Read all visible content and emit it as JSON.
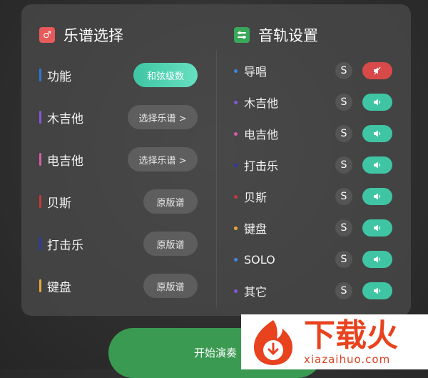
{
  "left": {
    "title": "乐谱选择",
    "icon": "music-note-icon",
    "rows": [
      {
        "label": "功能",
        "button": "和弦级数",
        "bar_color": "#2a78d8"
      },
      {
        "label": "木吉他",
        "button": "选择乐谱 >",
        "bar_color": "#8a55d8"
      },
      {
        "label": "电吉他",
        "button": "选择乐谱 >",
        "bar_color": "#d85aa8"
      },
      {
        "label": "贝斯",
        "button": "原版谱",
        "bar_color": "#c83838"
      },
      {
        "label": "打击乐",
        "button": "原版谱",
        "bar_color": "#2a3aa8"
      },
      {
        "label": "键盘",
        "button": "原版谱",
        "bar_color": "#e8a838"
      }
    ]
  },
  "right": {
    "title": "音轨设置",
    "icon": "track-settings-icon",
    "solo_label": "S",
    "tracks": [
      {
        "label": "导唱",
        "dot_color": "#3a8ae8",
        "enabled": false
      },
      {
        "label": "木吉他",
        "dot_color": "#8a55d8",
        "enabled": true
      },
      {
        "label": "电吉他",
        "dot_color": "#d85aa8",
        "enabled": true
      },
      {
        "label": "打击乐",
        "dot_color": "#2a3aa8",
        "enabled": true
      },
      {
        "label": "贝斯",
        "dot_color": "#c83838",
        "enabled": true
      },
      {
        "label": "键盘",
        "dot_color": "#e8a838",
        "enabled": true
      },
      {
        "label": "SOLO",
        "dot_color": "#3a8ae8",
        "enabled": true
      },
      {
        "label": "其它",
        "dot_color": "#8a55d8",
        "enabled": true
      }
    ]
  },
  "start_button": "开始演奏",
  "watermark": {
    "brand": "下载火",
    "url": "xiazaihuo.com"
  }
}
